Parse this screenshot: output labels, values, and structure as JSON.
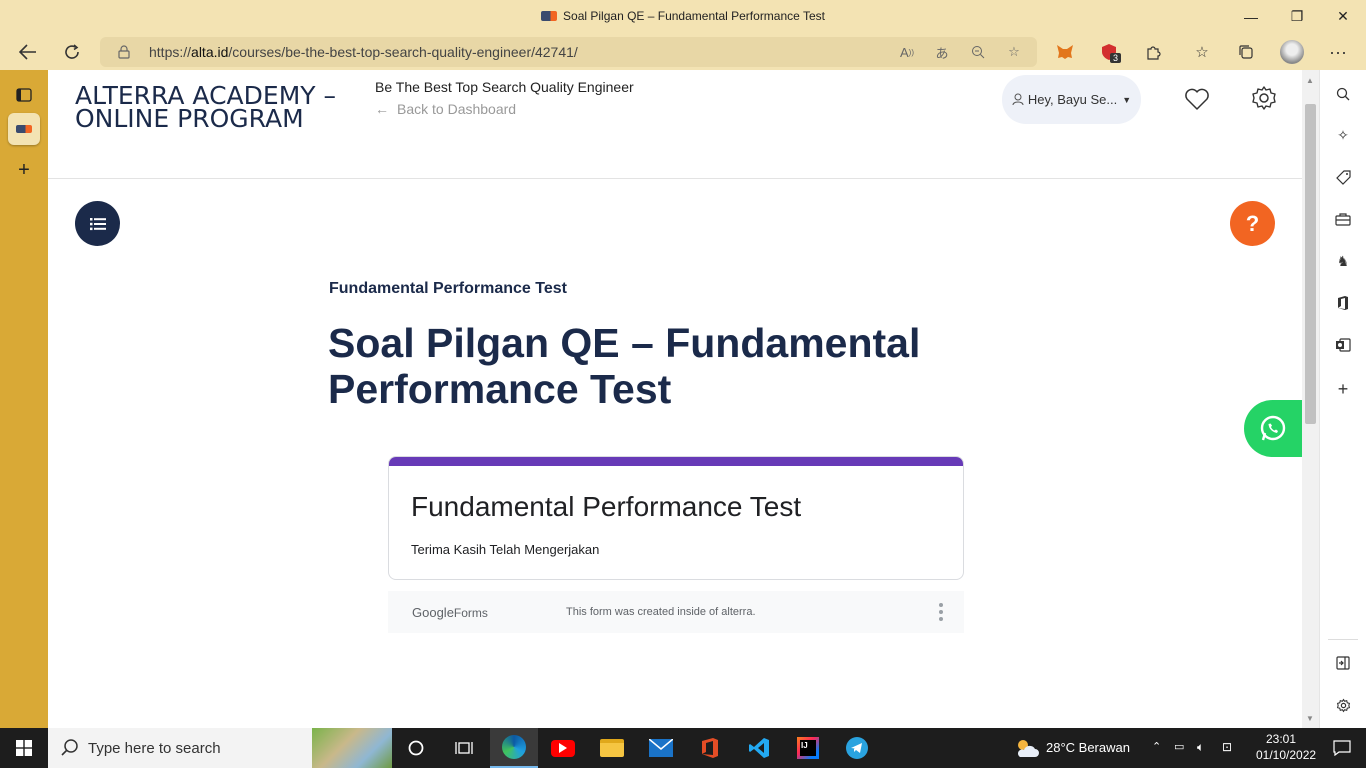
{
  "window": {
    "title": "Soal Pilgan QE – Fundamental Performance Test",
    "minimize": "—",
    "restore": "❐",
    "close": "✕"
  },
  "browser": {
    "url_prefix": "https://",
    "url_host": "alta.id",
    "url_path": "/courses/be-the-best-top-search-quality-engineer/42741/",
    "extension_badge": "3"
  },
  "site": {
    "logo": "ALTERRA ACADEMY – ONLINE PROGRAM",
    "course_title": "Be The Best Top Search Quality Engineer",
    "back_link": "Back to Dashboard",
    "user_greeting": "Hey, Bayu Se..."
  },
  "content": {
    "breadcrumb": "Fundamental Performance Test",
    "heading": "Soal Pilgan QE – Fundamental Performance Test",
    "help_label": "?"
  },
  "form": {
    "title": "Fundamental Performance Test",
    "message": "Terima Kasih Telah Mengerjakan",
    "brand_google": "Google",
    "brand_forms": "Forms",
    "note": "This form was created inside of alterra."
  },
  "taskbar": {
    "search_placeholder": "Type here to search",
    "weather": "28°C  Berawan",
    "time": "23:01",
    "date": "01/10/2022"
  },
  "colors": {
    "browser_frame": "#f3e3b3",
    "vertical_tabs": "#d9a936",
    "brand_navy": "#1b2a4a",
    "help_orange": "#f26522",
    "whatsapp_green": "#25d366",
    "forms_purple": "#673ab7"
  }
}
